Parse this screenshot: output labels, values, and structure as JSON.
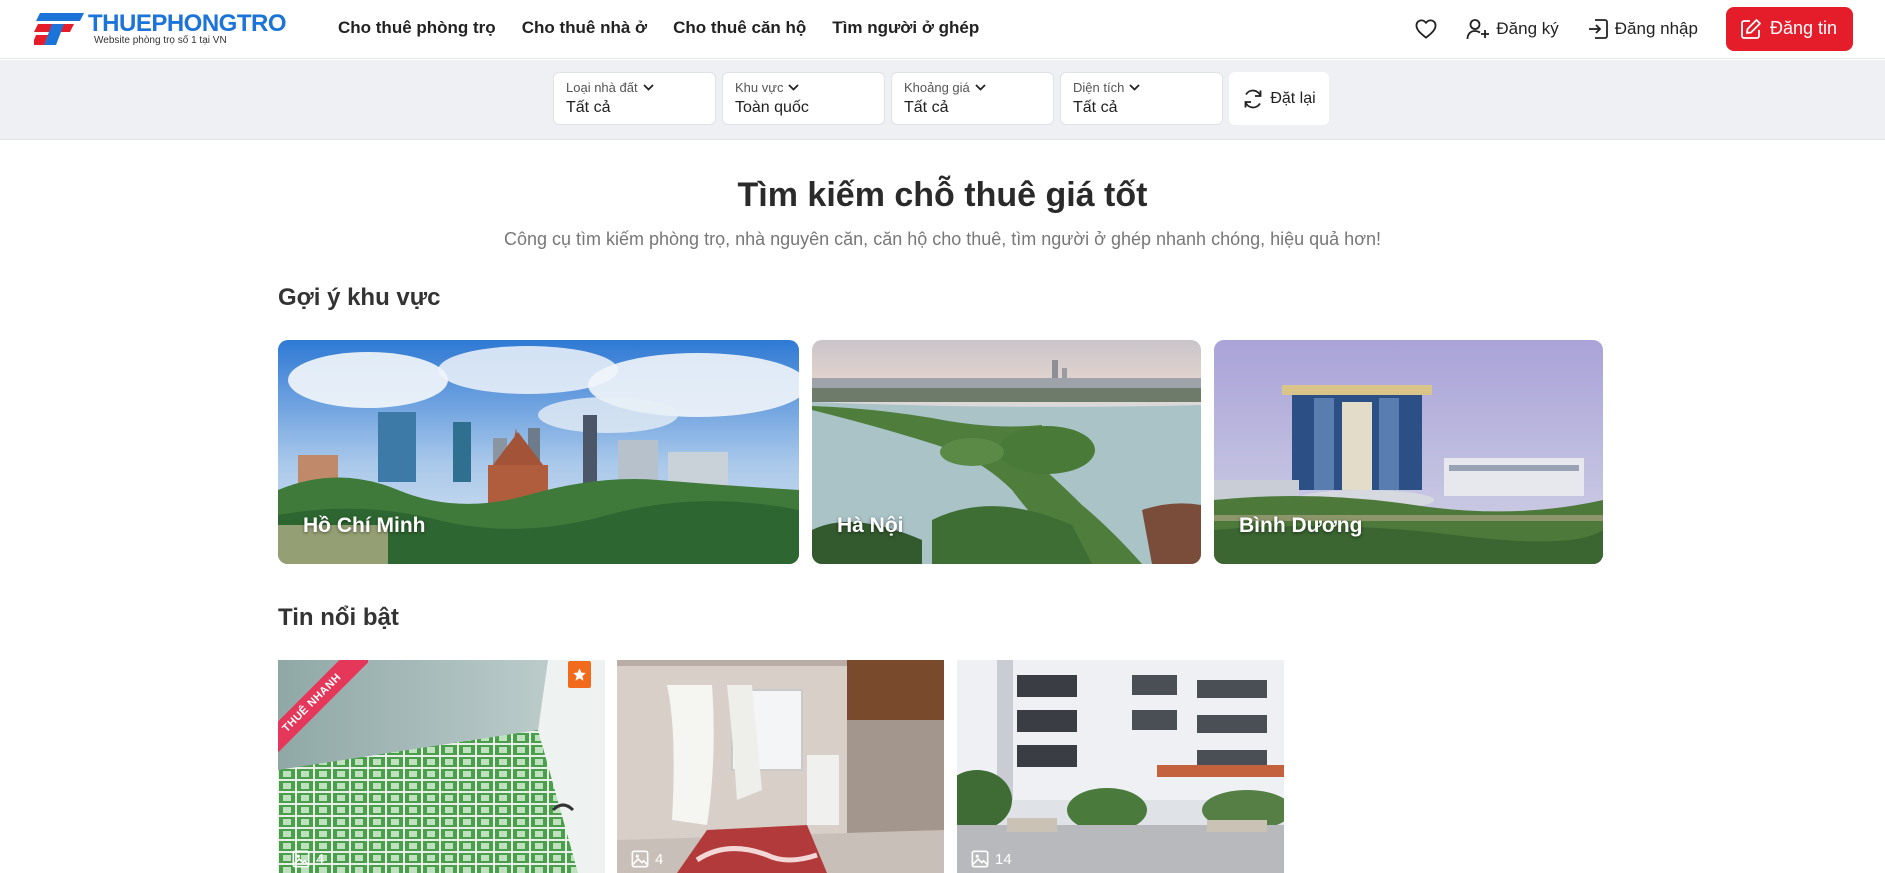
{
  "brand": {
    "name": "THUEPHONGTRO",
    "tagline": "Website phòng trọ số 1 tại VN"
  },
  "nav": {
    "items": [
      "Cho thuê phòng trọ",
      "Cho thuê nhà ở",
      "Cho thuê căn hộ",
      "Tìm người ở ghép"
    ]
  },
  "header_actions": {
    "register": "Đăng ký",
    "login": "Đăng nhập",
    "post": "Đăng tin"
  },
  "filters": [
    {
      "label": "Loại nhà đất",
      "value": "Tất cả"
    },
    {
      "label": "Khu vực",
      "value": "Toàn quốc"
    },
    {
      "label": "Khoảng giá",
      "value": "Tất cả"
    },
    {
      "label": "Diện tích",
      "value": "Tất cả"
    }
  ],
  "reset_label": "Đặt lại",
  "hero": {
    "title": "Tìm kiếm chỗ thuê giá tốt",
    "subtitle": "Công cụ tìm kiếm phòng trọ, nhà nguyên căn, căn hộ cho thuê, tìm người ở ghép nhanh chóng, hiệu quả hơn!"
  },
  "regions": {
    "title": "Gợi ý khu vực",
    "items": [
      "Hồ Chí Minh",
      "Hà Nội",
      "Bình Dương"
    ]
  },
  "featured": {
    "title": "Tin nổi bật",
    "ribbon": "THUÊ NHANH",
    "items": [
      {
        "photo_count": "4"
      },
      {
        "photo_count": "4"
      },
      {
        "photo_count": "14"
      }
    ]
  },
  "colors": {
    "brand_blue": "#1c73d8",
    "accent_red": "#e51d2a",
    "ribbon_pink": "#e5375a",
    "star_orange": "#f26b1d"
  },
  "icons": {
    "favorites": "heart-icon",
    "register": "user-plus-icon",
    "login": "login-icon",
    "post": "edit-icon",
    "dropdown": "chevron-down-icon",
    "reset": "refresh-icon",
    "photos": "image-icon",
    "featured": "star-icon"
  }
}
